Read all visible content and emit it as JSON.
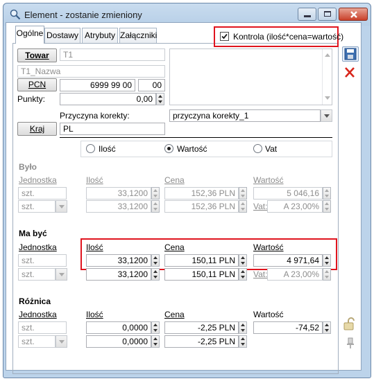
{
  "window": {
    "title": "Element - zostanie zmieniony"
  },
  "tabs": [
    {
      "label": "Ogólne"
    },
    {
      "label": "Dostawy"
    },
    {
      "label": "Atrybuty"
    },
    {
      "label": "Załączniki"
    }
  ],
  "kontrola": {
    "label": "Kontrola (ilość*cena=wartość)",
    "checked": true
  },
  "towar": {
    "button": "Towar",
    "code": "T1",
    "name": "T1_Nazwa"
  },
  "pcn": {
    "button": "PCN",
    "code": "6999 99 00",
    "suffix": "00"
  },
  "punkty": {
    "label": "Punkty:",
    "value": "0,00"
  },
  "przyczyna": {
    "label": "Przyczyna korekty:",
    "value": "przyczyna korekty_1"
  },
  "kraj": {
    "button": "Kraj",
    "value": "PL"
  },
  "radio": {
    "ilosc": "Ilość",
    "wartosc": "Wartość",
    "vat": "Vat",
    "selected": "wartosc"
  },
  "bylo": {
    "header": "Było",
    "col_jednostka": "Jednostka",
    "col_ilosc": "Ilość",
    "col_cena": "Cena",
    "col_wartosc": "Wartość",
    "unit1": "szt.",
    "unit2": "szt.",
    "ilosc1": "33,1200",
    "ilosc2": "33,1200",
    "cena1": "152,36 PLN",
    "cena2": "152,36 PLN",
    "wartosc1": "5 046,16",
    "vat_label": "Vat:",
    "vat_value": "A 23,00%"
  },
  "ma_byc": {
    "header": "Ma być",
    "col_jednostka": "Jednostka",
    "col_ilosc": "Ilość",
    "col_cena": "Cena",
    "col_wartosc": "Wartość",
    "unit1": "szt.",
    "unit2": "szt.",
    "ilosc1": "33,1200",
    "ilosc2": "33,1200",
    "cena1": "150,11 PLN",
    "cena2": "150,11 PLN",
    "wartosc1": "4 971,64",
    "vat_label": "Vat:",
    "vat_value": "A 23,00%"
  },
  "roznica": {
    "header": "Różnica",
    "col_jednostka": "Jednostka",
    "col_ilosc": "Ilość",
    "col_cena": "Cena",
    "col_wartosc": "Wartość",
    "unit1": "szt.",
    "unit2": "szt.",
    "ilosc1": "0,0000",
    "ilosc2": "0,0000",
    "cena1": "-2,25 PLN",
    "cena2": "-2,25 PLN",
    "wartosc1": "-74,52"
  },
  "colors": {
    "highlight": "#e0141e",
    "titlebar": "#bcd3ea",
    "disabled_text": "#8b8b8b"
  }
}
